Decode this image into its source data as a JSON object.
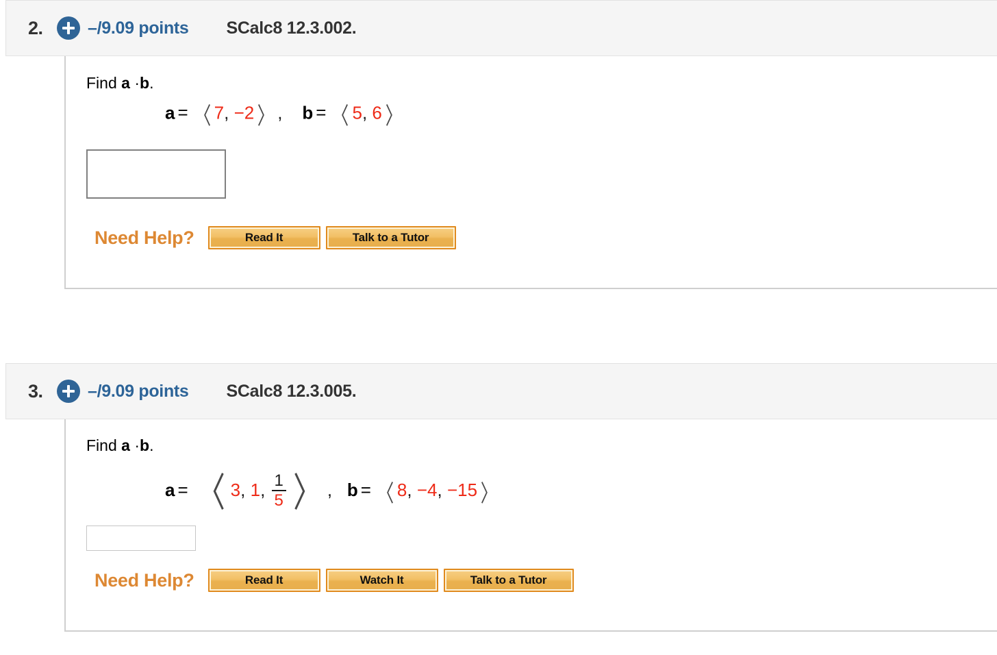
{
  "page": {
    "background": "#ffffff",
    "accent_blue": "#2d6498",
    "accent_orange": "#dd8833",
    "math_red": "#ee2b18",
    "header_bg": "#f5f5f5"
  },
  "questions": [
    {
      "number": "2.",
      "icon": "plus-circle-icon",
      "points": "–/9.09 points",
      "code": "SCalc8 12.3.002.",
      "prompt_prefix": "Find",
      "prompt_a": "a",
      "prompt_dot": "·",
      "prompt_b": "b",
      "prompt_period": ".",
      "math": {
        "a_label": "a",
        "a_equals": "=",
        "a_open": "〈",
        "a_components": [
          "7",
          ",",
          "−2"
        ],
        "a_close": "〉",
        "a_comma": ",",
        "b_label": "b",
        "b_equals": "=",
        "b_open": "〈",
        "b_components": [
          "5",
          ",",
          "6"
        ],
        "b_close": "〉"
      },
      "answer": {
        "value": "",
        "placeholder": ""
      },
      "help_label": "Need Help?",
      "help_buttons": [
        "Read It",
        "Talk to a Tutor"
      ]
    },
    {
      "number": "3.",
      "icon": "plus-circle-icon",
      "points": "–/9.09 points",
      "code": "SCalc8 12.3.005.",
      "prompt_prefix": "Find",
      "prompt_a": "a",
      "prompt_dot": "·",
      "prompt_b": "b",
      "prompt_period": ".",
      "math": {
        "a_label": "a",
        "a_equals": "=",
        "a_open": "〈",
        "a_first": "3",
        "a_comma1": ",",
        "a_second": "1",
        "a_comma2": ",",
        "a_frac_num": "1",
        "a_frac_den": "5",
        "a_close": "〉",
        "a_comma": ",",
        "b_label": "b",
        "b_equals": "=",
        "b_open": "〈",
        "b_first": "8",
        "b_comma1": ",",
        "b_second": "−4",
        "b_comma2": ",",
        "b_third": "−15",
        "b_close": "〉"
      },
      "answer": {
        "value": "",
        "placeholder": ""
      },
      "help_label": "Need Help?",
      "help_buttons": [
        "Read It",
        "Watch It",
        "Talk to a Tutor"
      ]
    }
  ]
}
